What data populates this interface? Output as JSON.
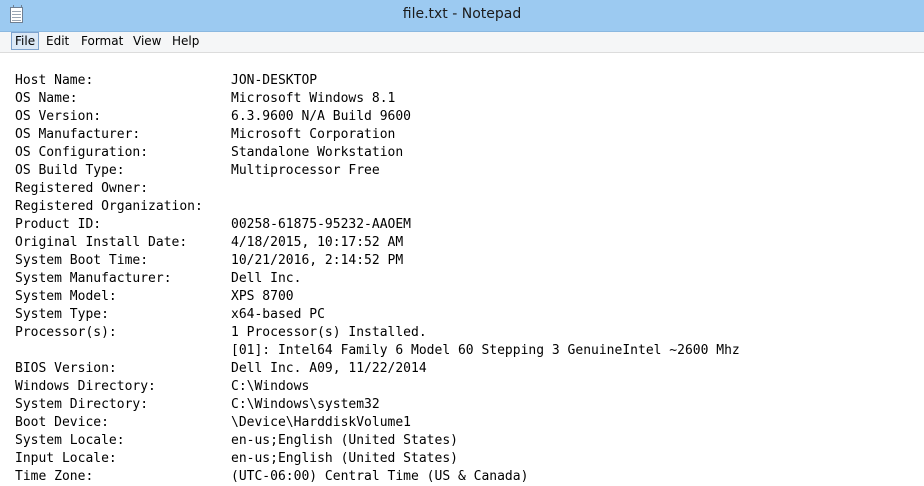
{
  "window": {
    "title": "file.txt - Notepad"
  },
  "menu": {
    "file": "File",
    "edit": "Edit",
    "format": "Format",
    "view": "View",
    "help": "Help"
  },
  "icons": {
    "app": "notepad-icon"
  },
  "text": {
    "lines": [
      {
        "label": "Host Name:",
        "value": "JON-DESKTOP"
      },
      {
        "label": "OS Name:",
        "value": "Microsoft Windows 8.1"
      },
      {
        "label": "OS Version:",
        "value": "6.3.9600 N/A Build 9600"
      },
      {
        "label": "OS Manufacturer:",
        "value": "Microsoft Corporation"
      },
      {
        "label": "OS Configuration:",
        "value": "Standalone Workstation"
      },
      {
        "label": "OS Build Type:",
        "value": "Multiprocessor Free"
      },
      {
        "label": "Registered Owner:",
        "value": ""
      },
      {
        "label": "Registered Organization:",
        "value": ""
      },
      {
        "label": "Product ID:",
        "value": "00258-61875-95232-AAOEM"
      },
      {
        "label": "Original Install Date:",
        "value": "4/18/2015, 10:17:52 AM"
      },
      {
        "label": "System Boot Time:",
        "value": "10/21/2016, 2:14:52 PM"
      },
      {
        "label": "System Manufacturer:",
        "value": "Dell Inc."
      },
      {
        "label": "System Model:",
        "value": "XPS 8700"
      },
      {
        "label": "System Type:",
        "value": "x64-based PC"
      },
      {
        "label": "Processor(s):",
        "value": "1 Processor(s) Installed."
      },
      {
        "label": "",
        "value": "[01]: Intel64 Family 6 Model 60 Stepping 3 GenuineIntel ~2600 Mhz"
      },
      {
        "label": "BIOS Version:",
        "value": "Dell Inc. A09, 11/22/2014"
      },
      {
        "label": "Windows Directory:",
        "value": "C:\\Windows"
      },
      {
        "label": "System Directory:",
        "value": "C:\\Windows\\system32"
      },
      {
        "label": "Boot Device:",
        "value": "\\Device\\HarddiskVolume1"
      },
      {
        "label": "System Locale:",
        "value": "en-us;English (United States)"
      },
      {
        "label": "Input Locale:",
        "value": "en-us;English (United States)"
      },
      {
        "label": "Time Zone:",
        "value": "(UTC-06:00) Central Time (US & Canada)"
      }
    ]
  }
}
